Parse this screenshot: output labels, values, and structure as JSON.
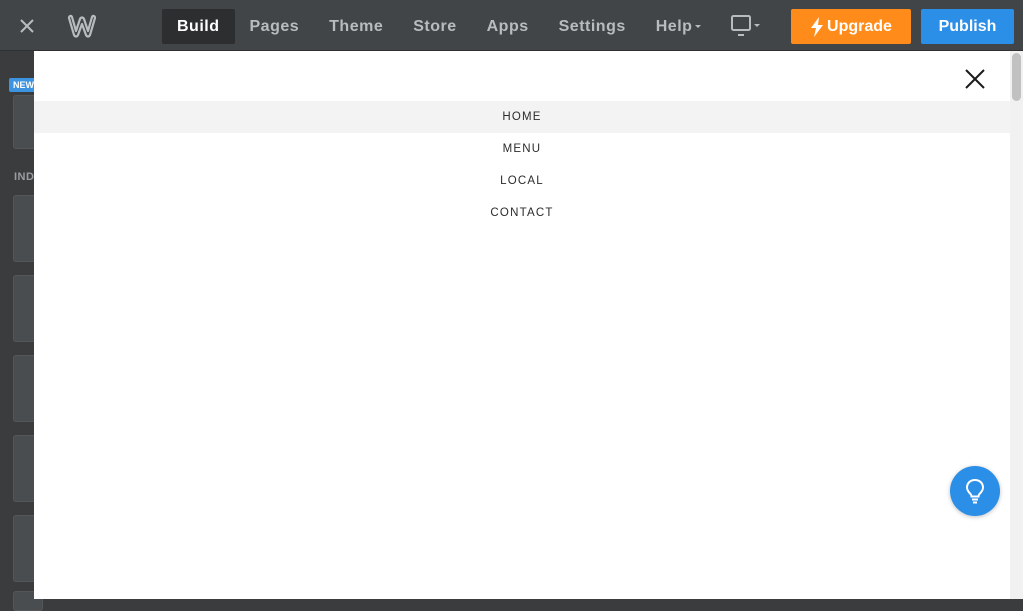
{
  "topbar": {
    "nav": [
      {
        "label": "Build",
        "active": true
      },
      {
        "label": "Pages"
      },
      {
        "label": "Theme"
      },
      {
        "label": "Store"
      },
      {
        "label": "Apps"
      },
      {
        "label": "Settings"
      },
      {
        "label": "Help"
      }
    ],
    "upgrade_label": "Upgrade",
    "publish_label": "Publish",
    "colors": {
      "upgrade": "#ff8c1a",
      "publish": "#2b8ee7",
      "bar": "#424548"
    }
  },
  "sidebar": {
    "new_badge": "NEW",
    "section_label": "IND"
  },
  "preview": {
    "menu_items": [
      {
        "label": "HOME",
        "active": true
      },
      {
        "label": "MENU"
      },
      {
        "label": "LOCAL"
      },
      {
        "label": "CONTACT"
      }
    ]
  },
  "icons": {
    "close": "close-icon",
    "logo": "weebly-logo-icon",
    "device": "desktop-icon",
    "bolt": "lightning-icon",
    "help": "lightbulb-icon"
  }
}
